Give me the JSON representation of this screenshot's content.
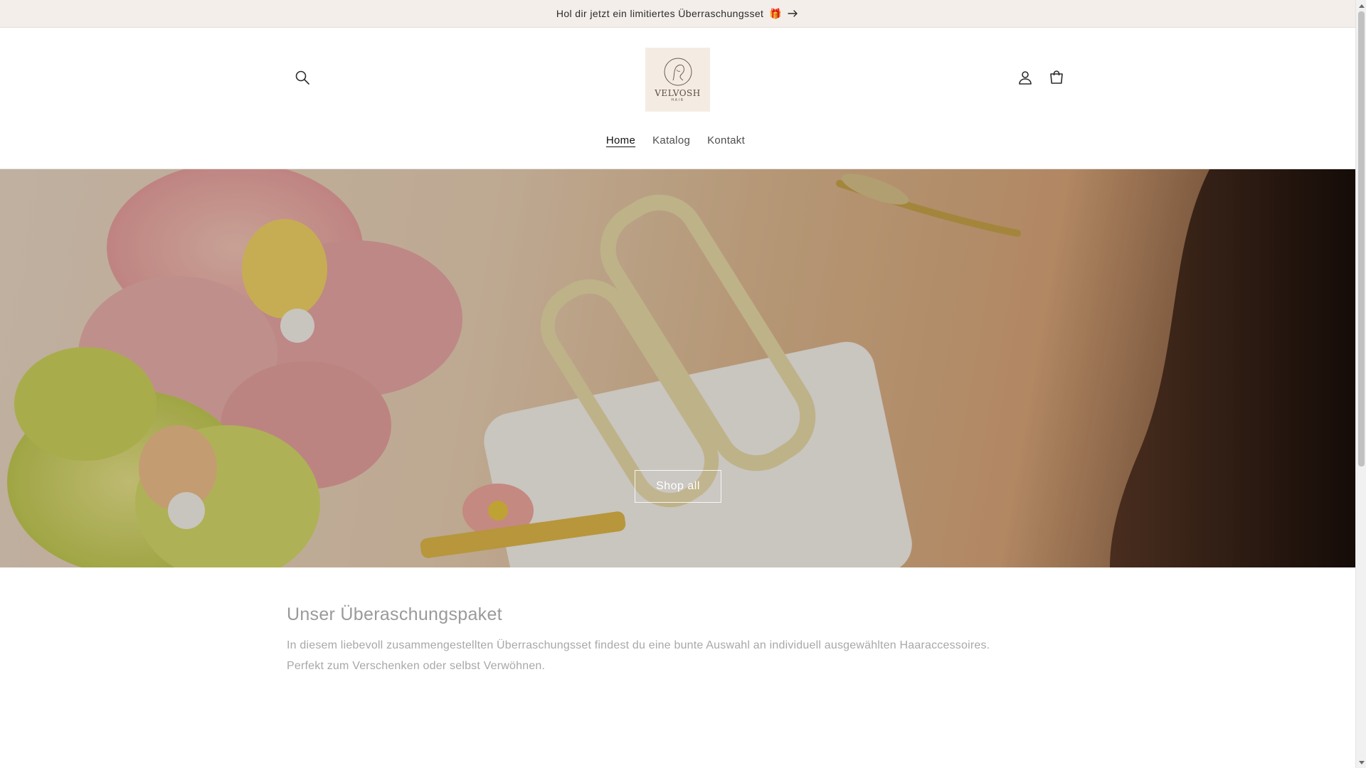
{
  "announcement": {
    "text": "Hol dir jetzt ein limitiertes Überraschungsset",
    "emoji": "🎁",
    "arrow_icon": "arrow-right-icon"
  },
  "header": {
    "search_icon": "search-icon",
    "account_icon": "account-icon",
    "cart_icon": "cart-icon",
    "logo": {
      "name": "VELVOSH",
      "sub": "HAIR"
    }
  },
  "nav": {
    "items": [
      {
        "label": "Home",
        "active": true
      },
      {
        "label": "Katalog",
        "active": false
      },
      {
        "label": "Kontakt",
        "active": false
      }
    ]
  },
  "hero": {
    "button_label": "Shop all"
  },
  "section": {
    "title": "Unser Überaschungspaket",
    "text": "In diesem liebevoll zusammengestellten Überraschungsset findest du eine bunte Auswahl an individuell ausgewählten Haaraccessoires. Perfekt zum Verschenken oder selbst Verwöhnen."
  },
  "colors": {
    "announcement_bg": "#f3eeea",
    "logo_bg": "#f4ece3",
    "text_muted": "#9a9a9a"
  }
}
